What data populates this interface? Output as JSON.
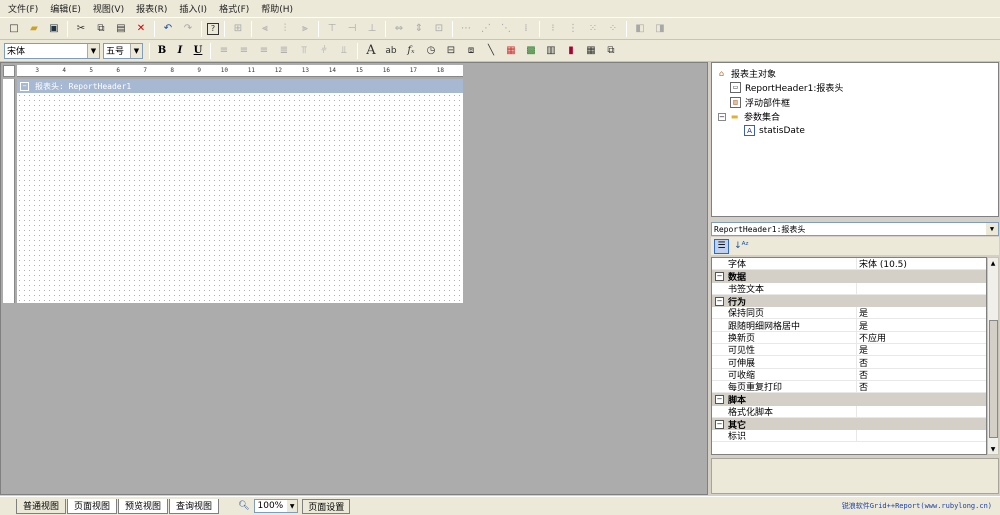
{
  "menubar": {
    "items": [
      "文件(F)",
      "编辑(E)",
      "视图(V)",
      "报表(R)",
      "插入(I)",
      "格式(F)",
      "帮助(H)"
    ]
  },
  "format_toolbar": {
    "font_name": "宋体",
    "font_size": "五号",
    "bold": "B",
    "italic": "I",
    "underline": "U"
  },
  "design": {
    "ruler_labels": [
      "3",
      "4",
      "5",
      "6",
      "7",
      "8",
      "9",
      "10",
      "11",
      "12",
      "13",
      "14",
      "15",
      "16",
      "17",
      "18"
    ],
    "band_title": "报表头: ReportHeader1",
    "band_collapse": "−"
  },
  "tree": {
    "root": "报表主对象",
    "items": [
      "ReportHeader1:报表头",
      "浮动部件框",
      "参数集合",
      "statisDate"
    ]
  },
  "object_selector": "ReportHeader1:报表头",
  "property_grid": {
    "top_row": {
      "key": "字体",
      "value": "宋体 (10.5)"
    },
    "sections": [
      {
        "name": "数据",
        "rows": [
          {
            "key": "书签文本",
            "value": ""
          }
        ]
      },
      {
        "name": "行为",
        "rows": [
          {
            "key": "保持同页",
            "value": "是"
          },
          {
            "key": "跟随明细网格居中",
            "value": "是"
          },
          {
            "key": "换新页",
            "value": "不应用"
          },
          {
            "key": "可见性",
            "value": "是"
          },
          {
            "key": "可伸展",
            "value": "否"
          },
          {
            "key": "可收缩",
            "value": "否"
          },
          {
            "key": "每页重复打印",
            "value": "否"
          }
        ]
      },
      {
        "name": "脚本",
        "rows": [
          {
            "key": "格式化脚本",
            "value": ""
          }
        ]
      },
      {
        "name": "其它",
        "rows": [
          {
            "key": "标识",
            "value": ""
          }
        ]
      }
    ]
  },
  "statusbar": {
    "tabs": [
      "普通视图",
      "页面视图",
      "预览视图",
      "查询视图"
    ],
    "selected_tab": "普通视图",
    "zoom": "100%",
    "page_setup": "页面设置",
    "brand": "锐浪软件Grid++Report(www.rubylong.cn)"
  }
}
